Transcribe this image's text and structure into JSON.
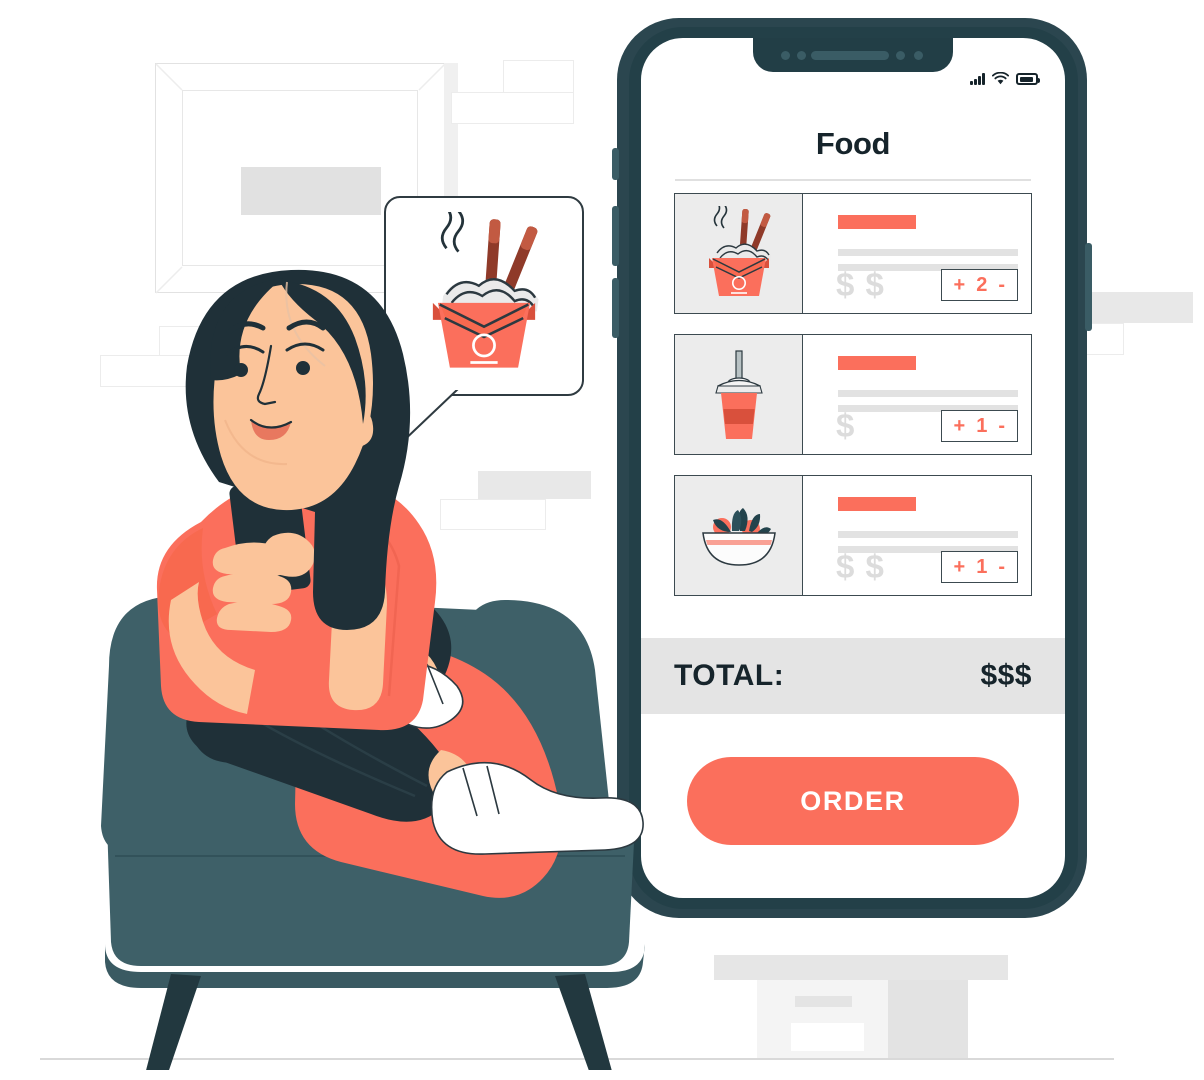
{
  "scene": {
    "title": "Food ordering app illustration",
    "palette": {
      "accent": "#fb6f5c",
      "accent_dark": "#d9503c",
      "navy": "#1f3038",
      "phone_frame": "#2b464f",
      "chair": "#3e6068",
      "chair_dark": "#22383f",
      "skin": "#fbc49a",
      "grey_bg": "#e8e8e8",
      "grey_line": "#e2e2e2",
      "price_grey": "#dcdcdc"
    }
  },
  "phone": {
    "status_bar": {
      "signal_icon": "signal-bars-icon",
      "wifi_icon": "wifi-icon",
      "battery_icon": "battery-icon"
    },
    "screen_title": "Food",
    "items": [
      {
        "thumb_icon": "noodle-box-icon",
        "name_placeholder": "",
        "price": "$ $",
        "quantity": "2",
        "plus_label": "+",
        "minus_label": "-"
      },
      {
        "thumb_icon": "soda-cup-icon",
        "name_placeholder": "",
        "price": "$",
        "quantity": "1",
        "plus_label": "+",
        "minus_label": "-"
      },
      {
        "thumb_icon": "salad-bowl-icon",
        "name_placeholder": "",
        "price": "$ $",
        "quantity": "1",
        "plus_label": "+",
        "minus_label": "-"
      }
    ],
    "total": {
      "label": "TOTAL:",
      "value": "$$$"
    },
    "order_button": {
      "label": "ORDER"
    }
  },
  "bubble": {
    "icon": "noodle-box-icon"
  }
}
